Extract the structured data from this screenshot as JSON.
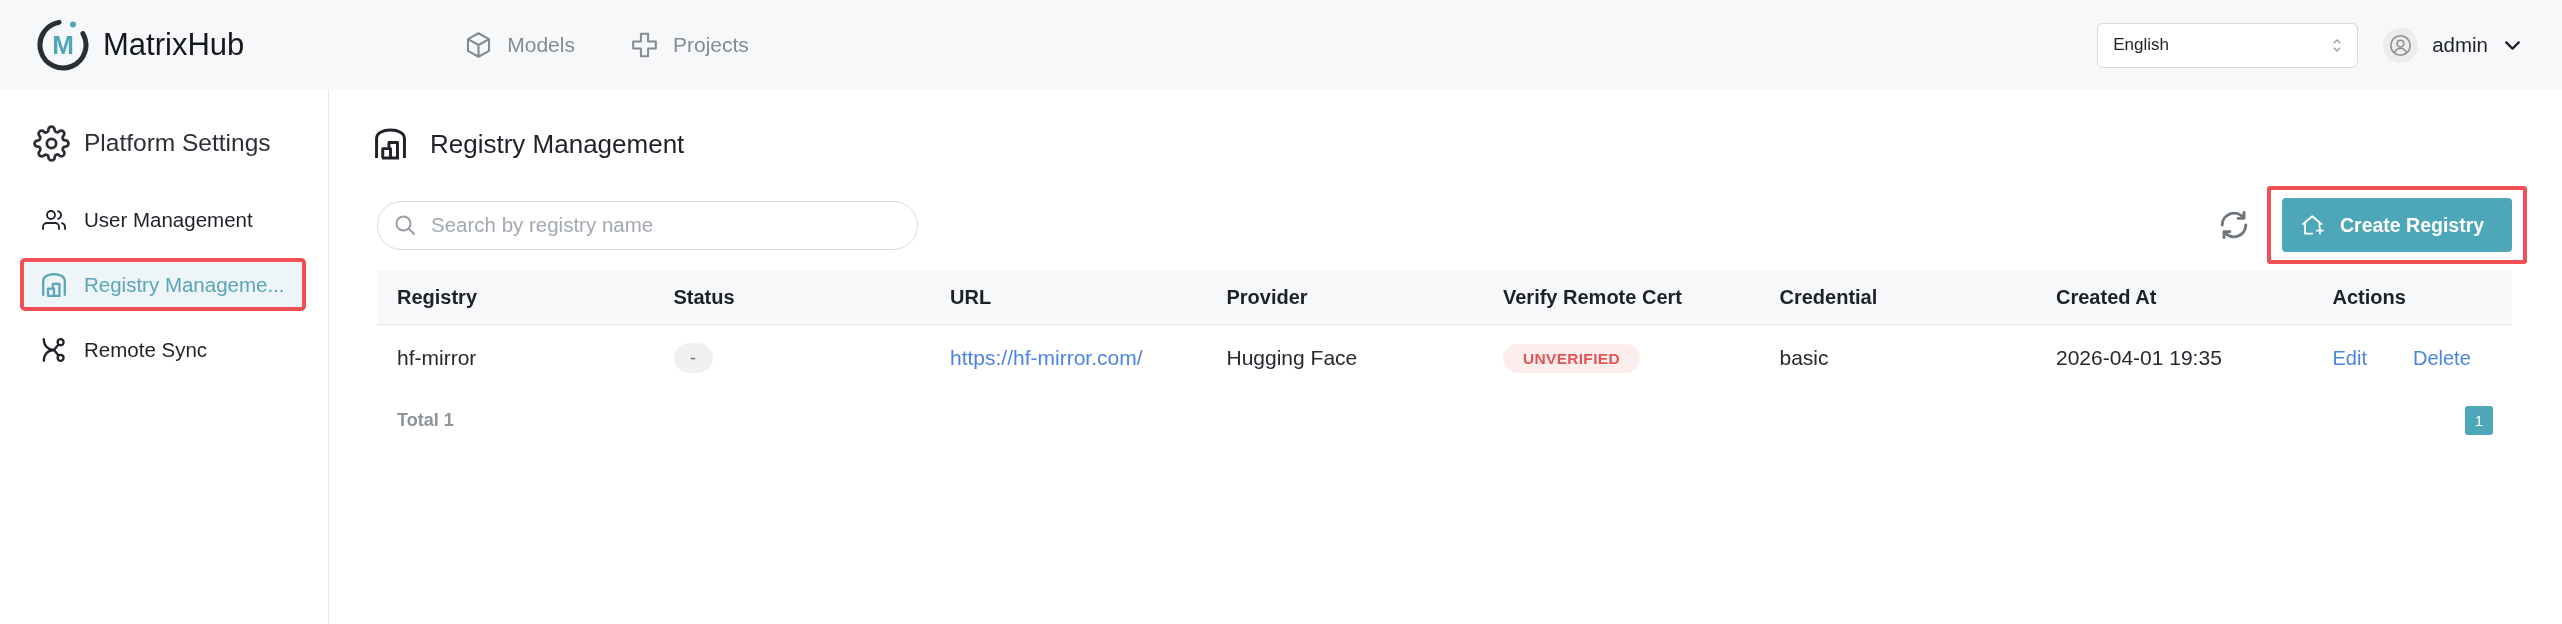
{
  "header": {
    "logo": {
      "letter": "M"
    },
    "brand": "MatrixHub",
    "nav": [
      {
        "label": "Models",
        "selected": false
      },
      {
        "label": "Projects",
        "selected": false
      }
    ],
    "language_select": {
      "value": "English"
    },
    "user": {
      "name": "admin"
    }
  },
  "sidebar": {
    "title": "Platform Settings",
    "items": [
      {
        "label": "User Management",
        "selected": false,
        "highlighted": false
      },
      {
        "label": "Registry Manageme...",
        "selected": true,
        "highlighted": true
      },
      {
        "label": "Remote Sync",
        "selected": false,
        "highlighted": false
      }
    ]
  },
  "main": {
    "title": "Registry Management",
    "search": {
      "placeholder": "Search by registry name"
    },
    "create_button": {
      "label": "Create Registry",
      "highlighted": true
    },
    "table": {
      "columns": [
        "Registry",
        "Status",
        "URL",
        "Provider",
        "Verify Remote Cert",
        "Credential",
        "Created At",
        "Actions"
      ],
      "rows": [
        {
          "registry": "hf-mirror",
          "status": "-",
          "url": "https://hf-mirror.com/",
          "provider": "Hugging Face",
          "verify_remote_cert": {
            "label": "UNVERIFIED",
            "verified": false
          },
          "credential": "basic",
          "created_at": "2026-04-01 19:35",
          "actions": [
            "Edit",
            "Delete"
          ]
        }
      ]
    },
    "total": "Total 1",
    "pagination": [
      {
        "label": "1",
        "selected": true
      }
    ]
  }
}
